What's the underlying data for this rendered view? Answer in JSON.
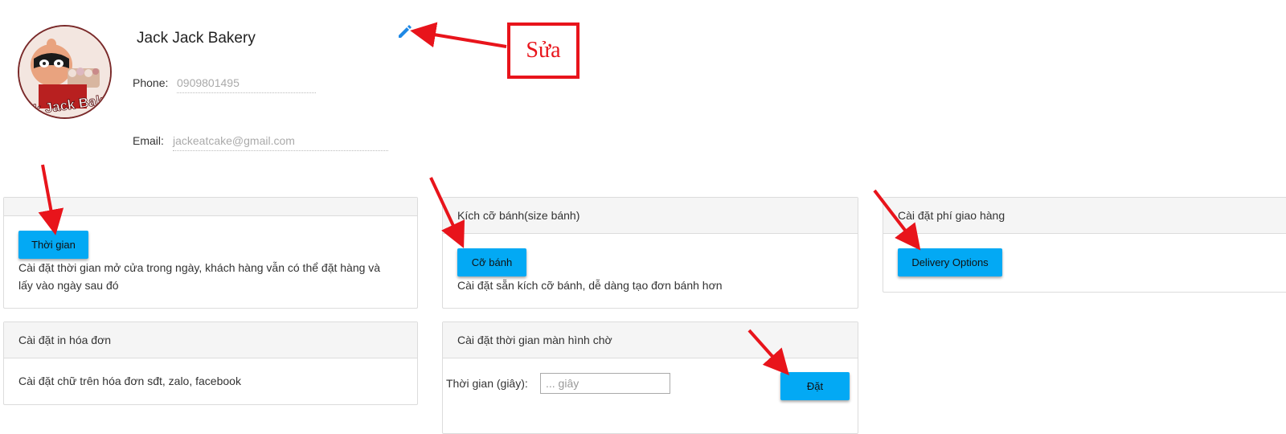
{
  "profile": {
    "shop_name": "Jack Jack Bakery",
    "avatar_text": "Jack Jack Baker",
    "phone_label": "Phone:",
    "phone_value": "0909801495",
    "email_label": "Email:",
    "email_value": "jackeatcake@gmail.com"
  },
  "annotation": {
    "edit_note": "Sửa"
  },
  "cards": {
    "opening_time": {
      "header": "",
      "button": "Thời gian",
      "description_line1": "Cài đặt thời gian mở cửa trong ngày, khách hàng vẫn có thể đặt hàng và",
      "description_line2": "lấy vào ngày sau đó"
    },
    "cake_size": {
      "header": "Kích cỡ bánh(size bánh)",
      "button": "Cỡ bánh",
      "description": "Cài đặt sẵn kích cỡ bánh, dễ dàng tạo đơn bánh hơn"
    },
    "delivery_fee": {
      "header": "Cài đặt phí giao hàng",
      "button": "Delivery Options"
    },
    "invoice_print": {
      "header": "Cài đặt in hóa đơn",
      "description": "Cài đặt chữ trên hóa đơn sđt, zalo, facebook"
    },
    "screensaver": {
      "header": "Cài đặt thời gian màn hình chờ",
      "time_label": "Thời gian (giây):",
      "time_placeholder": "... giây",
      "button": "Đặt"
    }
  },
  "colors": {
    "accent_button": "#03a9f4",
    "annotation_red": "#e8141b",
    "edit_icon": "#1e88e5"
  }
}
